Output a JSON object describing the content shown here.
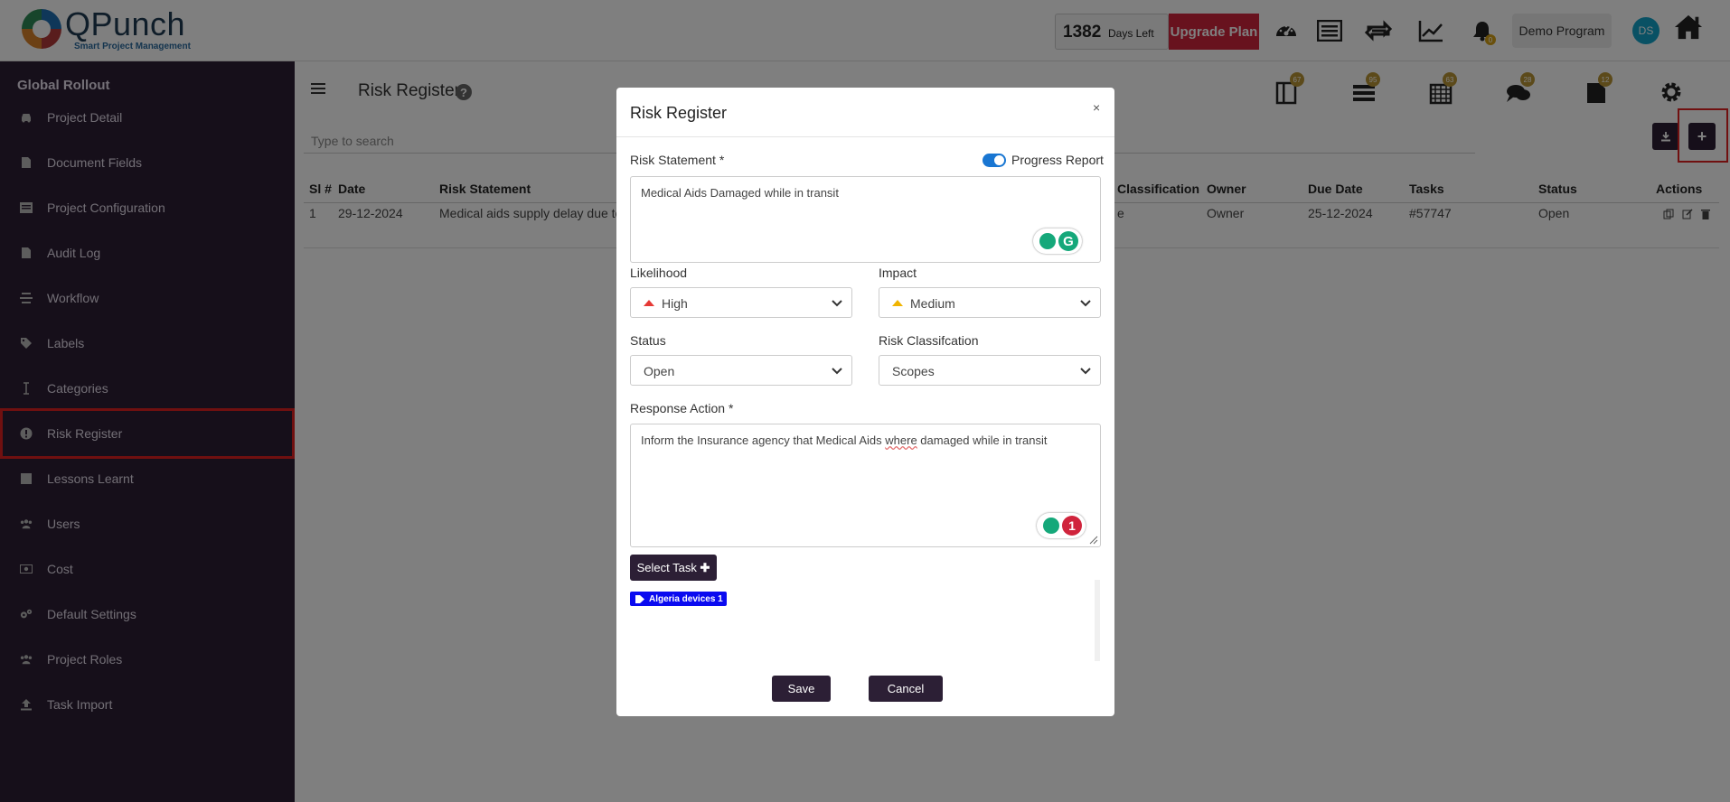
{
  "brand": {
    "name": "QPunch",
    "tagline": "Smart Project Management"
  },
  "header": {
    "days_left_count": "1382",
    "days_left_label": "Days Left",
    "upgrade_label": "Upgrade Plan",
    "notification_count": "0",
    "program_name": "Demo Program",
    "avatar_initials": "DS",
    "icons": [
      "dashboard-icon",
      "list-icon",
      "sync-icon",
      "chart-icon",
      "bell-icon",
      "home-icon"
    ]
  },
  "sidebar": {
    "title": "Global Rollout",
    "items": [
      {
        "label": "Project Detail",
        "icon": "car-icon"
      },
      {
        "label": "Document Fields",
        "icon": "file-icon"
      },
      {
        "label": "Project Configuration",
        "icon": "list-icon"
      },
      {
        "label": "Audit Log",
        "icon": "file-icon"
      },
      {
        "label": "Workflow",
        "icon": "stack-icon"
      },
      {
        "label": "Labels",
        "icon": "tags-icon"
      },
      {
        "label": "Categories",
        "icon": "cursor-icon"
      },
      {
        "label": "Risk Register",
        "icon": "exclamation-icon",
        "active": true
      },
      {
        "label": "Lessons Learnt",
        "icon": "square-icon"
      },
      {
        "label": "Users",
        "icon": "users-icon"
      },
      {
        "label": "Cost",
        "icon": "money-icon"
      },
      {
        "label": "Default Settings",
        "icon": "cogs-icon"
      },
      {
        "label": "Project Roles",
        "icon": "users-icon"
      },
      {
        "label": "Task Import",
        "icon": "upload-icon"
      }
    ]
  },
  "main": {
    "title": "Risk Register",
    "search_placeholder": "Type to search",
    "toolbar_badges": [
      "67",
      "95",
      "63",
      "28",
      "12"
    ],
    "table": {
      "headers": [
        "Sl #",
        "Date",
        "Risk Statement",
        "Classification",
        "Owner",
        "Due Date",
        "Tasks",
        "Status",
        "Actions"
      ],
      "rows": [
        {
          "sl": "1",
          "date": "29-12-2024",
          "statement": "Medical aids supply delay due to",
          "classification": "e",
          "owner": "Owner",
          "due": "25-12-2024",
          "tasks": "#57747",
          "status": "Open"
        }
      ]
    }
  },
  "modal": {
    "title": "Risk Register",
    "close": "×",
    "risk_statement_label": "Risk Statement *",
    "progress_report_label": "Progress Report",
    "progress_report_on": true,
    "risk_statement_value": "Medical Aids Damaged while in transit",
    "likelihood_label": "Likelihood",
    "likelihood_value": "High",
    "impact_label": "Impact",
    "impact_value": "Medium",
    "status_label": "Status",
    "status_value": "Open",
    "classification_label": "Risk Classifcation",
    "classification_value": "Scopes",
    "response_label": "Response Action *",
    "response_value_1": "Inform the Insurance agency that Medical Aids ",
    "response_value_2": "where",
    "response_value_3": " damaged while in transit",
    "grammarly_count": "1",
    "select_task_label": "Select Task",
    "selected_task": "Algeria devices 1",
    "save_label": "Save",
    "cancel_label": "Cancel",
    "colors": {
      "high": "#e53935",
      "medium": "#f0b400",
      "primary": "#2c1f35",
      "chip": "#0a0af0"
    }
  }
}
